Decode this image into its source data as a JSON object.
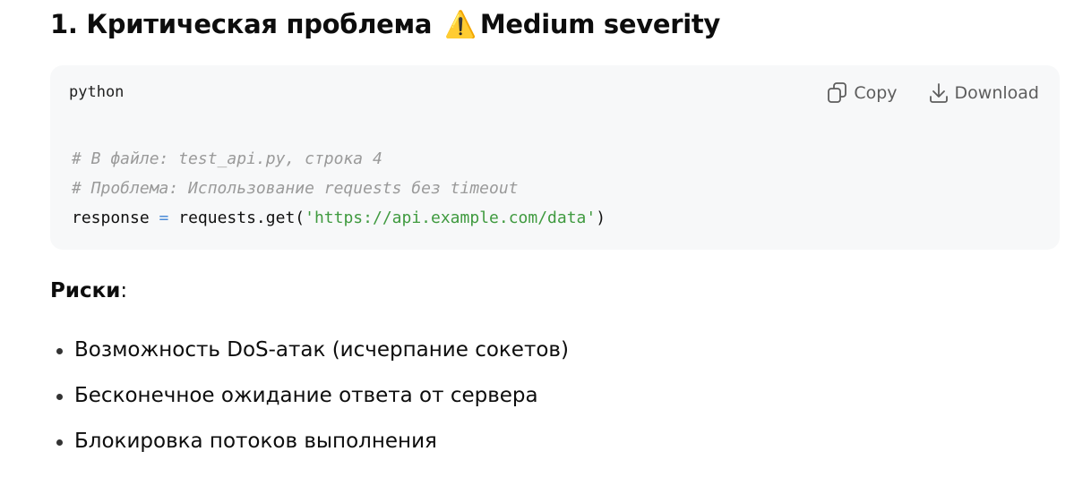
{
  "heading": {
    "number": "1.",
    "title": "Критическая проблема",
    "warning_icon": "⚠️",
    "severity": "Medium severity"
  },
  "code_block": {
    "language": "python",
    "copy_label": "Copy",
    "download_label": "Download",
    "lines": {
      "comment1": "# В файле: test_api.py, строка 4",
      "comment2": "# Проблема: Использование requests без timeout",
      "code_var": "response",
      "code_op": "=",
      "code_call": "requests.get(",
      "code_str": "'https://api.example.com/data'",
      "code_close": ")"
    }
  },
  "risks": {
    "label": "Риски",
    "colon": ":",
    "items": [
      "Возможность DoS-атак (исчерпание сокетов)",
      "Бесконечное ожидание ответа от сервера",
      "Блокировка потоков выполнения"
    ]
  },
  "icons": {
    "copy": "copy-icon",
    "download": "download-icon",
    "warning": "warning-icon"
  }
}
